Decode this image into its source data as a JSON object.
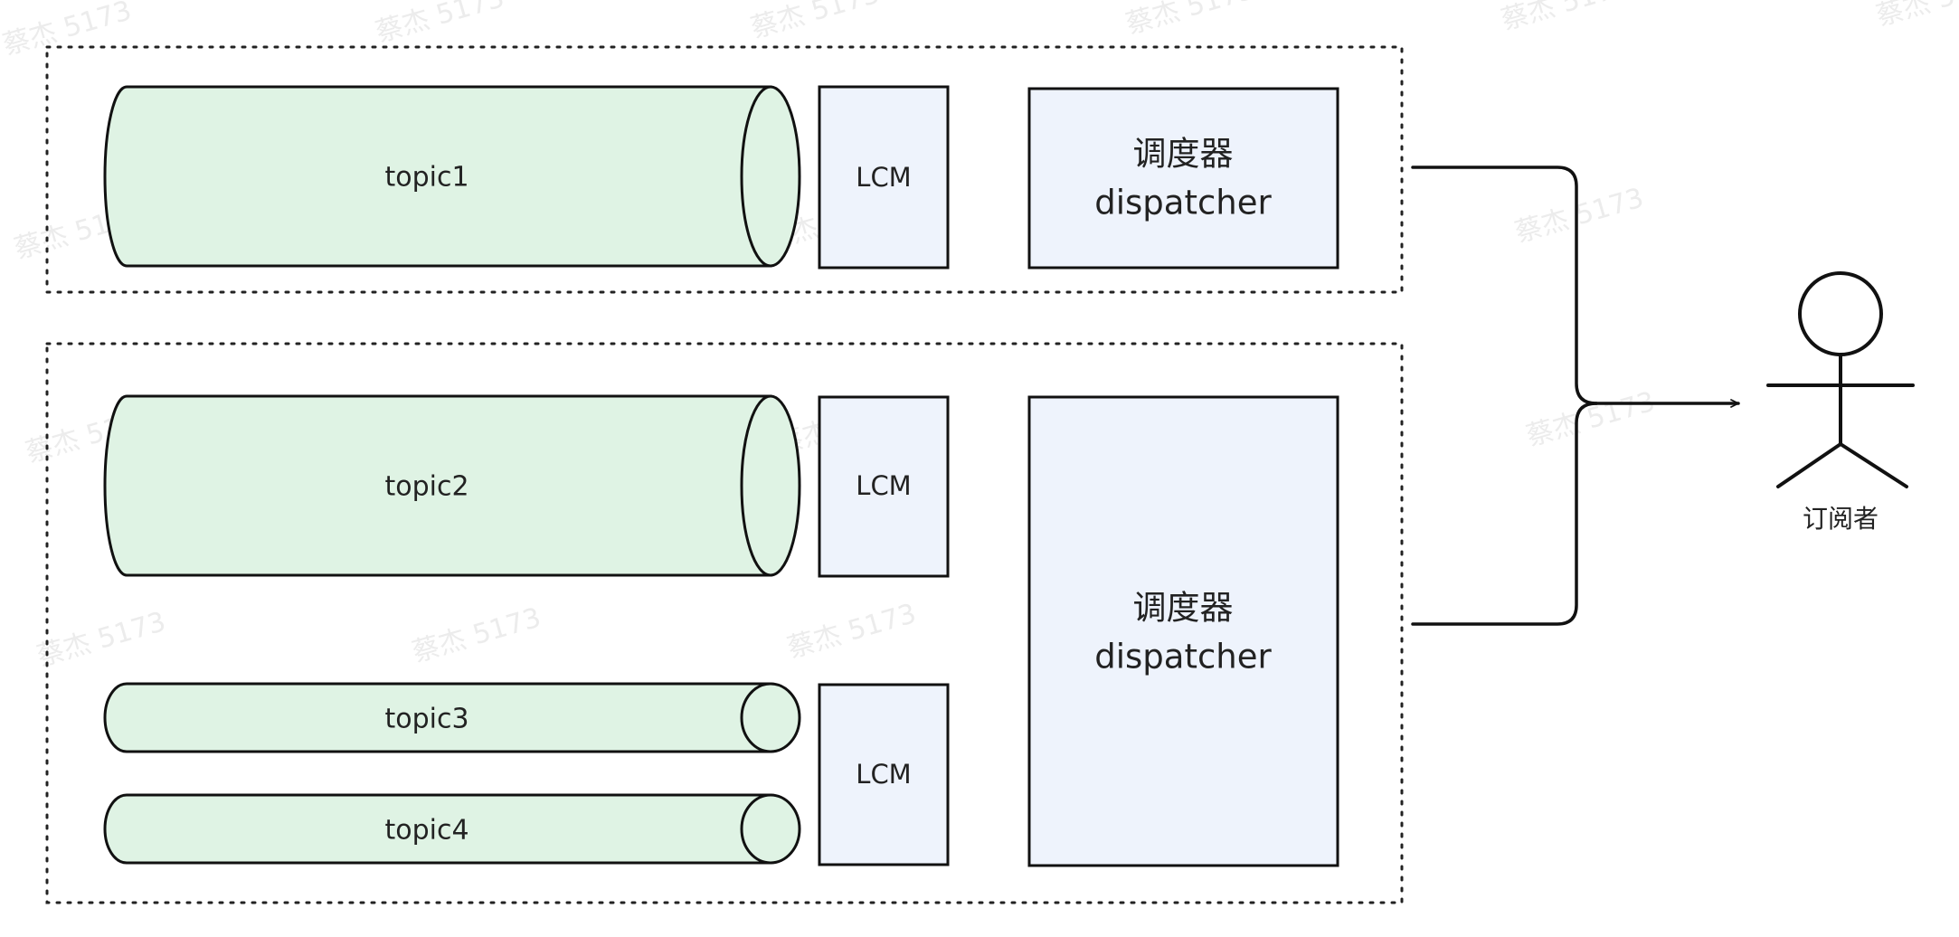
{
  "watermark": "蔡杰 5173",
  "colors": {
    "topic_fill": "#dff3e4",
    "box_fill": "#eef3fc",
    "stroke": "#111111"
  },
  "groups": [
    {
      "topics": [
        "topic1"
      ],
      "lcms": [
        "LCM"
      ],
      "dispatcher": {
        "cn": "调度器",
        "en": "dispatcher"
      }
    },
    {
      "topics": [
        "topic2",
        "topic3",
        "topic4"
      ],
      "lcms": [
        "LCM",
        "LCM"
      ],
      "dispatcher": {
        "cn": "调度器",
        "en": "dispatcher"
      }
    }
  ],
  "subscriber": {
    "label": "订阅者",
    "icon": "stick-figure-icon"
  }
}
